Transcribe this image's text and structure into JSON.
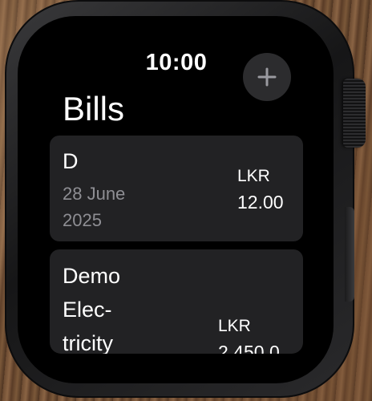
{
  "status_bar": {
    "time": "10:00"
  },
  "header": {
    "title": "Bills",
    "add_icon": "plus-icon"
  },
  "bills": [
    {
      "name": "D",
      "date_line1": "28 June",
      "date_line2": "2025",
      "currency": "LKR",
      "amount": "12.00"
    },
    {
      "name_line1": "Demo",
      "name_line2": "Elec-",
      "name_line3": "tricity",
      "currency": "LKR",
      "amount": "2,450.0"
    }
  ],
  "colors": {
    "screen_background": "#000000",
    "card_background": "#222224",
    "secondary_text": "#8e8e93",
    "button_background": "#2c2c2e"
  }
}
